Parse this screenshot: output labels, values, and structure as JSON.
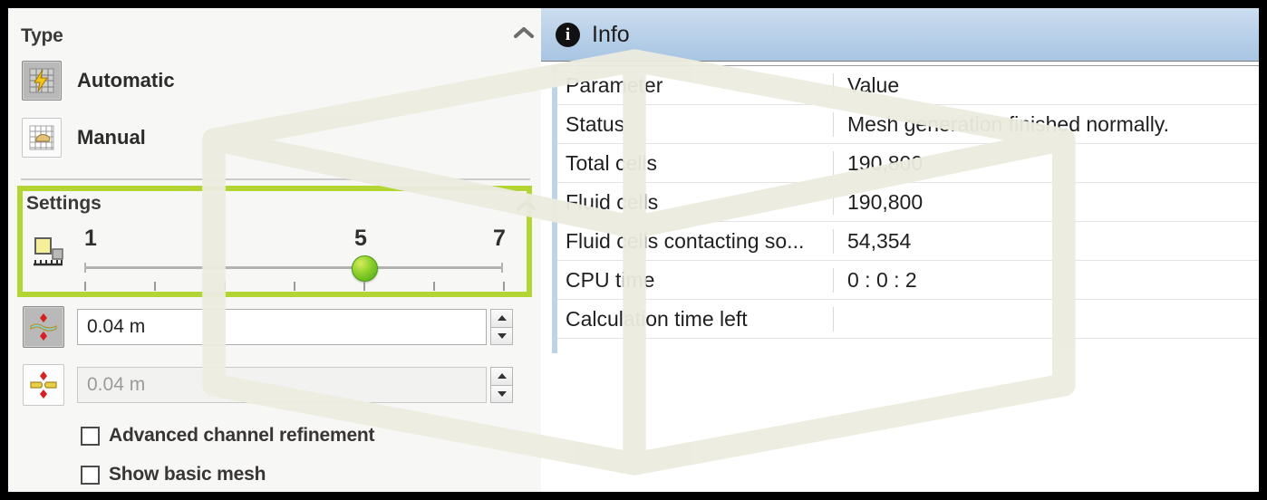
{
  "left_panel": {
    "type_section": {
      "title": "Type",
      "collapse_icon": "chevron-up-icon",
      "options": [
        {
          "label": "Automatic",
          "icon": "automatic-mesh-icon",
          "selected": true
        },
        {
          "label": "Manual",
          "icon": "manual-mesh-icon",
          "selected": false
        }
      ]
    },
    "settings_section": {
      "title": "Settings",
      "collapse_icon": "chevron-up-icon",
      "highlight_color": "#b3d533",
      "slider": {
        "icon": "level-of-initial-mesh-icon",
        "min_label": "1",
        "current_label": "5",
        "max_label": "7",
        "min": 1,
        "max": 7,
        "value": 5,
        "tick_count": 7
      },
      "fields": [
        {
          "icon": "minimum-gap-size-icon",
          "value": "0.04 m",
          "placeholder": "0.04 m",
          "enabled": true,
          "spinner_up": "spin-up-icon",
          "spinner_down": "spin-down-icon"
        },
        {
          "icon": "minimum-wall-thickness-icon",
          "value": "0.04 m",
          "placeholder": "0.04 m",
          "enabled": false,
          "spinner_up": "spin-up-icon",
          "spinner_down": "spin-down-icon"
        }
      ],
      "checkboxes": [
        {
          "label": "Advanced channel refinement",
          "checked": false
        },
        {
          "label": "Show basic mesh",
          "checked": false
        }
      ]
    }
  },
  "right_panel": {
    "header": {
      "title": "Info",
      "icon": "info-icon"
    },
    "table": {
      "columns": [
        "Parameter",
        "Value"
      ],
      "rows": [
        {
          "parameter": "Parameter",
          "value": "Value",
          "is_header": true
        },
        {
          "parameter": "Status",
          "value": "Mesh generation finished normally."
        },
        {
          "parameter": "Total cells",
          "value": "190,800"
        },
        {
          "parameter": "Fluid cells",
          "value": "190,800"
        },
        {
          "parameter": "Fluid cells contacting so...",
          "value": "54,354"
        },
        {
          "parameter": "CPU time",
          "value": "0 : 0 : 2"
        },
        {
          "parameter": "Calculation time left",
          "value": ""
        }
      ]
    }
  }
}
